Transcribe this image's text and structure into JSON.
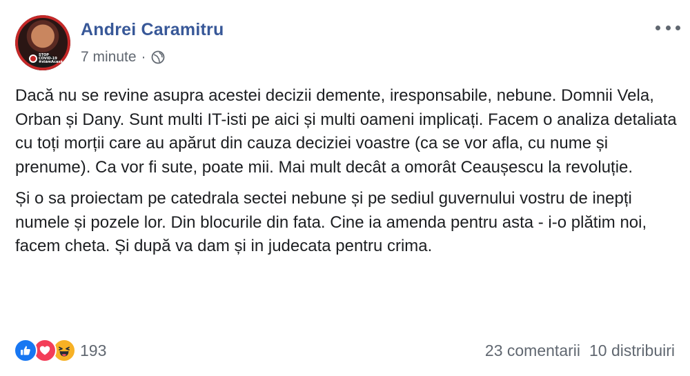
{
  "post": {
    "author": "Andrei Caramitru",
    "time": "7 minute",
    "separator": "·",
    "privacy_icon": "globe-icon",
    "avatar_badge_text": "STOP\nCOVID-19\n#stămAcasă",
    "paragraphs": [
      "Dacă nu se revine asupra acestei decizii demente, iresponsabile, nebune. Domnii Vela, Orban și Dany. Sunt multi IT-isti pe aici și multi oameni implicați. Facem o analiza detaliata cu toți morții care au apărut din cauza deciziei voastre (ca se vor afla, cu nume și prenume). Ca vor fi sute, poate mii. Mai mult decât a omorât Ceaușescu la revoluție.",
      "Și o sa proiectam pe catedrala sectei nebune și pe sediul guvernului vostru de inepți numele și pozele lor. Din blocurile din fata. Cine ia amenda pentru asta - i-o plătim noi, facem cheta. Și după va dam și in judecata pentru crima."
    ],
    "reactions": {
      "icons": [
        "like-icon",
        "love-icon",
        "haha-icon"
      ],
      "count": "193"
    },
    "comments": "23 comentarii",
    "shares": "10 distribuiri"
  },
  "colors": {
    "author_link": "#385898",
    "meta_gray": "#606770",
    "like": "#1877f2",
    "love": "#f33e58",
    "haha": "#f7b125",
    "avatar_frame": "#c62828"
  }
}
